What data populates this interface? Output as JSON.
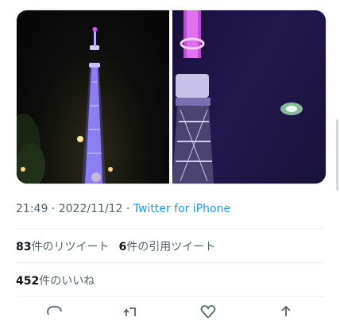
{
  "media": {
    "photos": [
      {
        "icon": "tower-night-photo"
      },
      {
        "icon": "tower-closeup-ufo-photo"
      }
    ]
  },
  "tweet_meta": {
    "time": "21:49",
    "separator1": " · ",
    "date": "2022/11/12",
    "separator2": " · ",
    "source": "Twitter for iPhone"
  },
  "stats": {
    "retweets_count": "83",
    "retweets_label": "件のリツイート",
    "quotes_count": "6",
    "quotes_label": "件の引用ツイート",
    "likes_count": "452",
    "likes_label": "件のいいね"
  },
  "actions": [
    {
      "icon": "reply-icon"
    },
    {
      "icon": "retweet-icon"
    },
    {
      "icon": "like-icon"
    },
    {
      "icon": "share-icon"
    }
  ],
  "colors": {
    "accent": "#1d9bf0",
    "muted": "#536471",
    "text": "#0f1419"
  }
}
